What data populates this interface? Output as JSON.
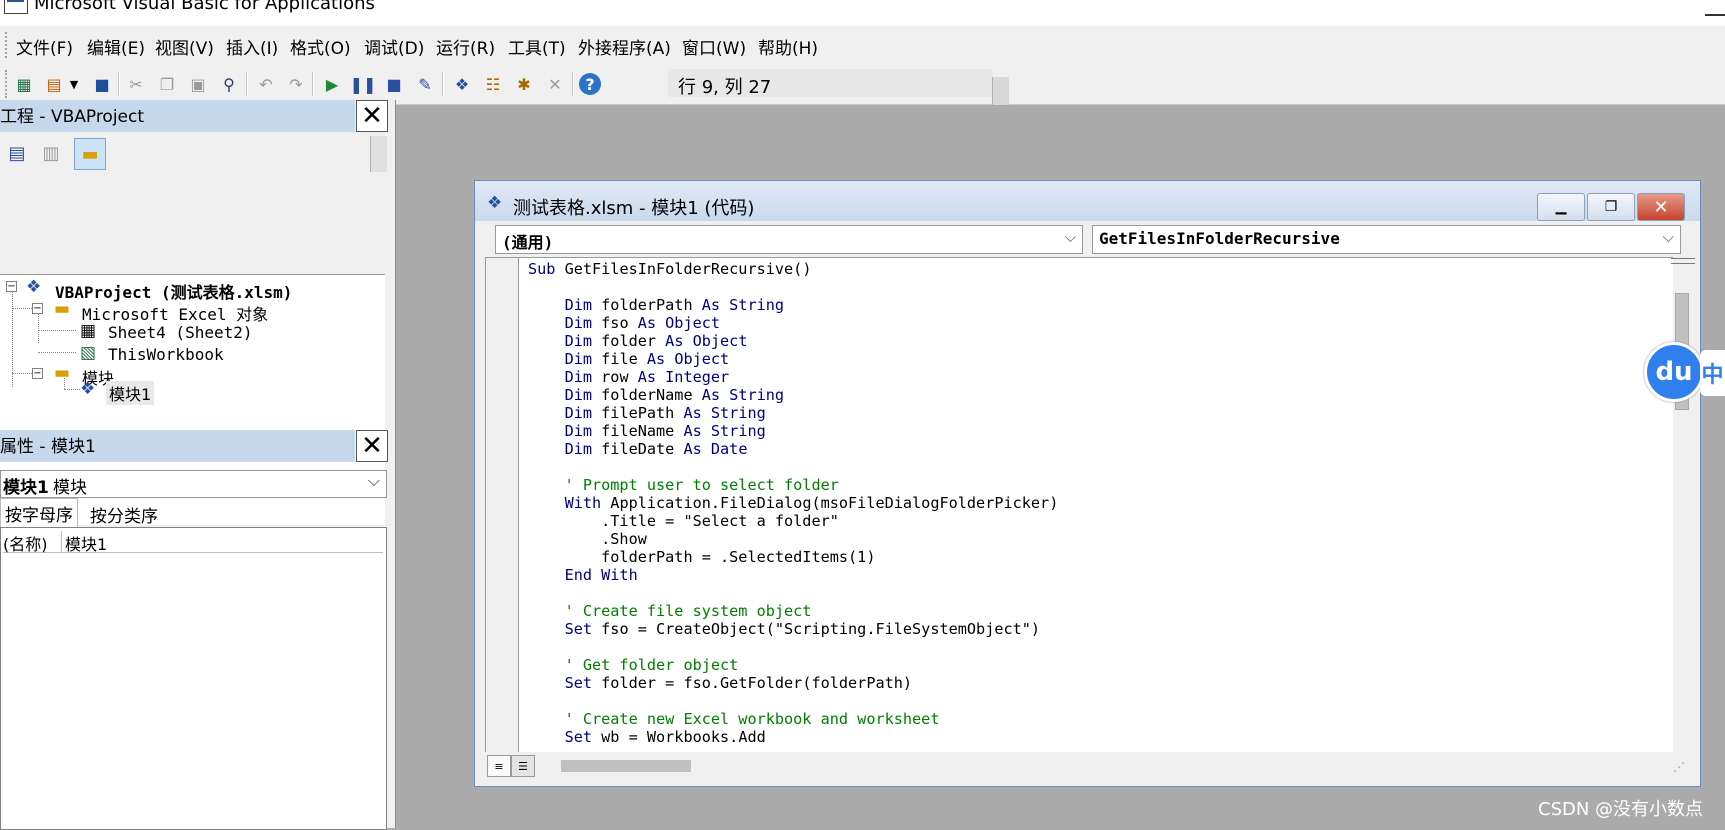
{
  "window": {
    "title": "Microsoft Visual Basic for Applications"
  },
  "menubar": {
    "items": [
      "文件(F)",
      "编辑(E)",
      "视图(V)",
      "插入(I)",
      "格式(O)",
      "调试(D)",
      "运行(R)",
      "工具(T)",
      "外接程序(A)",
      "窗口(W)",
      "帮助(H)"
    ]
  },
  "toolbar": {
    "status": "行 9, 列 27",
    "icons": [
      "excel-view-icon",
      "insert-module-icon",
      "save-icon",
      "cut-icon",
      "copy-icon",
      "paste-icon",
      "find-icon",
      "undo-icon",
      "redo-icon",
      "run-icon",
      "break-icon",
      "reset-icon",
      "design-mode-icon",
      "project-explorer-icon",
      "properties-icon",
      "object-browser-icon",
      "toolbox-icon",
      "help-icon"
    ]
  },
  "project_pane": {
    "title": "工程 - VBAProject",
    "tree": {
      "root": "VBAProject (测试表格.xlsm)",
      "excel_objects": "Microsoft Excel 对象",
      "sheet": "Sheet4 (Sheet2)",
      "workbook": "ThisWorkbook",
      "modules_folder": "模块",
      "module": "模块1"
    }
  },
  "properties_pane": {
    "title": "属性 - 模块1",
    "object_name": "模块1",
    "object_type": "模块",
    "tabs": [
      "按字母序",
      "按分类序"
    ],
    "rows": [
      {
        "key": "(名称)",
        "value": "模块1"
      }
    ]
  },
  "code_window": {
    "title": "测试表格.xlsm - 模块1 (代码)",
    "object_combo": "(通用)",
    "procedure_combo": "GetFilesInFolderRecursive",
    "lines": [
      [
        {
          "t": "Sub",
          "c": "kw"
        },
        {
          "t": " GetFilesInFolderRecursive()",
          "c": ""
        }
      ],
      [],
      [
        {
          "t": "    Dim",
          "c": "kw"
        },
        {
          "t": " folderPath ",
          "c": ""
        },
        {
          "t": "As String",
          "c": "kw"
        }
      ],
      [
        {
          "t": "    Dim",
          "c": "kw"
        },
        {
          "t": " fso ",
          "c": ""
        },
        {
          "t": "As Object",
          "c": "kw"
        }
      ],
      [
        {
          "t": "    Dim",
          "c": "kw"
        },
        {
          "t": " folder ",
          "c": ""
        },
        {
          "t": "As Object",
          "c": "kw"
        }
      ],
      [
        {
          "t": "    Dim",
          "c": "kw"
        },
        {
          "t": " file ",
          "c": ""
        },
        {
          "t": "As Object",
          "c": "kw"
        }
      ],
      [
        {
          "t": "    Dim",
          "c": "kw"
        },
        {
          "t": " row ",
          "c": ""
        },
        {
          "t": "As Integer",
          "c": "kw"
        }
      ],
      [
        {
          "t": "    Dim",
          "c": "kw"
        },
        {
          "t": " folderName ",
          "c": ""
        },
        {
          "t": "As String",
          "c": "kw"
        }
      ],
      [
        {
          "t": "    Dim",
          "c": "kw"
        },
        {
          "t": " filePath ",
          "c": ""
        },
        {
          "t": "As String",
          "c": "kw"
        }
      ],
      [
        {
          "t": "    Dim",
          "c": "kw"
        },
        {
          "t": " fileName ",
          "c": ""
        },
        {
          "t": "As String",
          "c": "kw"
        }
      ],
      [
        {
          "t": "    Dim",
          "c": "kw"
        },
        {
          "t": " fileDate ",
          "c": ""
        },
        {
          "t": "As Date",
          "c": "kw"
        }
      ],
      [],
      [
        {
          "t": "    ' Prompt user to select folder",
          "c": "cm"
        }
      ],
      [
        {
          "t": "    With",
          "c": "kw"
        },
        {
          "t": " Application.FileDialog(msoFileDialogFolderPicker)",
          "c": ""
        }
      ],
      [
        {
          "t": "        .Title = \"Select a folder\"",
          "c": ""
        }
      ],
      [
        {
          "t": "        .Show",
          "c": ""
        }
      ],
      [
        {
          "t": "        folderPath = .SelectedItems(1)",
          "c": ""
        }
      ],
      [
        {
          "t": "    End With",
          "c": "kw"
        }
      ],
      [],
      [
        {
          "t": "    ' Create file system object",
          "c": "cm"
        }
      ],
      [
        {
          "t": "    Set",
          "c": "kw"
        },
        {
          "t": " fso = CreateObject(\"Scripting.FileSystemObject\")",
          "c": ""
        }
      ],
      [],
      [
        {
          "t": "    ' Get folder object",
          "c": "cm"
        }
      ],
      [
        {
          "t": "    Set",
          "c": "kw"
        },
        {
          "t": " folder = fso.GetFolder(folderPath)",
          "c": ""
        }
      ],
      [],
      [
        {
          "t": "    ' Create new Excel workbook and worksheet",
          "c": "cm"
        }
      ],
      [
        {
          "t": "    Set",
          "c": "kw"
        },
        {
          "t": " wb = Workbooks.Add",
          "c": ""
        }
      ]
    ]
  },
  "overlay": {
    "du_badge": "du",
    "du_tab": "中"
  },
  "watermark": "CSDN @没有小数点",
  "colors": {
    "keyword": "#00007f",
    "comment": "#007f00",
    "pane_title": "#c6d8ec",
    "mdi_background": "#ababab"
  }
}
